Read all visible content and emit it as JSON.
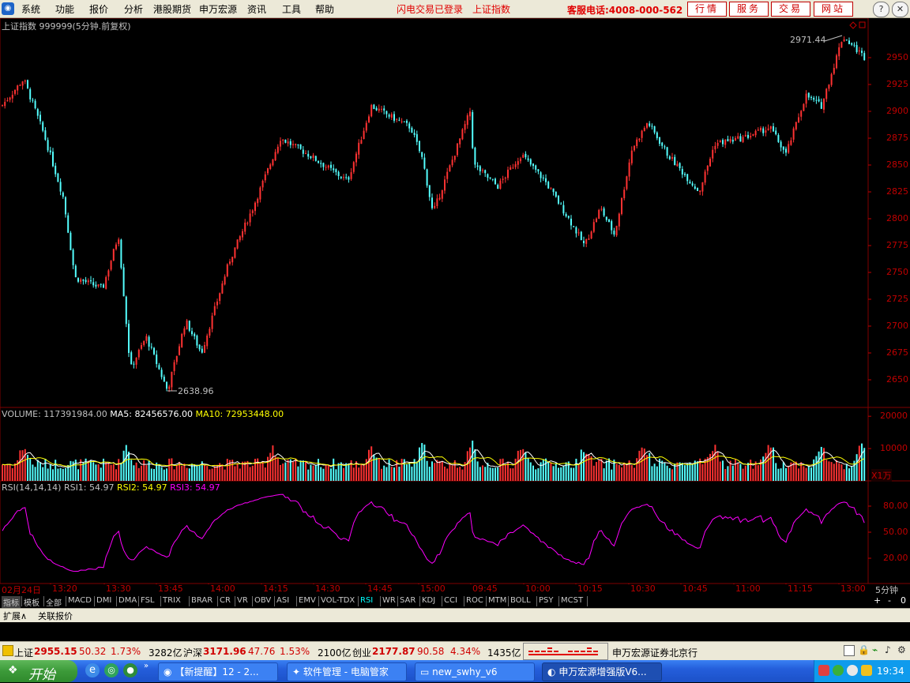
{
  "menu": {
    "items": [
      "系统",
      "功能",
      "报价",
      "分析",
      "港股期货",
      "申万宏源",
      "资讯",
      "工具",
      "帮助"
    ],
    "red_items": [
      "闪电交易已登录",
      "上证指数"
    ],
    "hotline": "客服电话:4008-000-562",
    "buttons": [
      "行情",
      "服务",
      "交易",
      "网站"
    ]
  },
  "chart": {
    "title": "上证指数 999999(5分钟.前复权)",
    "max_label": "2971.44",
    "min_label": "2638.96",
    "price_ticks": [
      "2950",
      "2925",
      "2900",
      "2875",
      "2850",
      "2825",
      "2800",
      "2775",
      "2750",
      "2725",
      "2700",
      "2675",
      "2650"
    ],
    "volume_legend": {
      "volume": "VOLUME: 117391984.00",
      "ma5": "MA5: 82456576.00",
      "ma10": "MA10: 72953448.00"
    },
    "volume_ticks": [
      "20000",
      "10000"
    ],
    "volume_unit": "X1万",
    "rsi_legend": {
      "name": "RSI(14,14,14)",
      "rsi1": "RSI1: 54.97",
      "rsi2": "RSI2: 54.97",
      "rsi3": "RSI3: 54.97"
    },
    "rsi_ticks": [
      "80.00",
      "50.00",
      "20.00"
    ],
    "time_labels": [
      "02月24日",
      "13:20",
      "13:30",
      "13:45",
      "14:00",
      "14:15",
      "14:30",
      "14:45",
      "15:00",
      "09:45",
      "10:00",
      "10:15",
      "10:30",
      "10:45",
      "11:00",
      "11:15",
      "13:00"
    ],
    "period": "5分钟",
    "colors": {
      "up": "#ff3232",
      "down": "#54ffff",
      "rsi": "#ff00ff",
      "ma5": "#ffffff",
      "ma10": "#ffff00",
      "grid": "#800000",
      "axis_text": "#c00000"
    }
  },
  "indicators": {
    "tabs": [
      "指标",
      "模板",
      "全部",
      "MACD",
      "DMI",
      "DMA",
      "FSL",
      "TRIX",
      "BRAR",
      "CR",
      "VR",
      "OBV",
      "ASI",
      "EMV",
      "VOL-TDX",
      "RSI",
      "WR",
      "SAR",
      "KDJ",
      "CCI",
      "ROC",
      "MTM",
      "BOLL",
      "PSY",
      "MCST"
    ],
    "active": "RSI",
    "controls": [
      "+",
      "-",
      "0"
    ]
  },
  "ext_tabs": [
    "扩展∧",
    "关联报价"
  ],
  "status": {
    "sh_label": "上证",
    "sh_price": "2955.15",
    "sh_change": "50.32",
    "sh_pct": "1.73%",
    "sh_amount": "3282亿",
    "hs_label": "沪深",
    "hs_price": "3171.96",
    "hs_change": "47.76",
    "hs_pct": "1.53%",
    "hs_amount": "2100亿",
    "cy_label": "创业",
    "cy_price": "2177.87",
    "cy_change": "90.58",
    "cy_pct": "4.34%",
    "cy_amount": "1435亿",
    "broker": "申万宏源证券北京行"
  },
  "taskbar": {
    "start": "开始",
    "tasks": [
      "【新提醒】12 - 2...",
      "软件管理 - 电脑管家",
      "new_swhy_v6",
      "申万宏源增强版V6..."
    ],
    "clock": "19:34"
  }
}
